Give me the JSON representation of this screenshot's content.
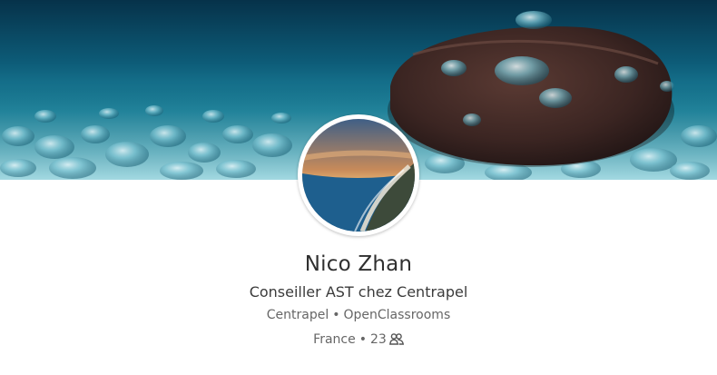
{
  "profile": {
    "name": "Nico Zhan",
    "headline": "Conseiller AST chez Centrapel",
    "companies": [
      "Centrapel",
      "OpenClassrooms"
    ],
    "separator": "•",
    "location": "France",
    "connections": "23"
  },
  "icons": {
    "connections": "people-icon"
  },
  "colors": {
    "name_text": "#2f2f2f",
    "secondary_text": "#666666",
    "cover_primary": "#0d5c78"
  }
}
